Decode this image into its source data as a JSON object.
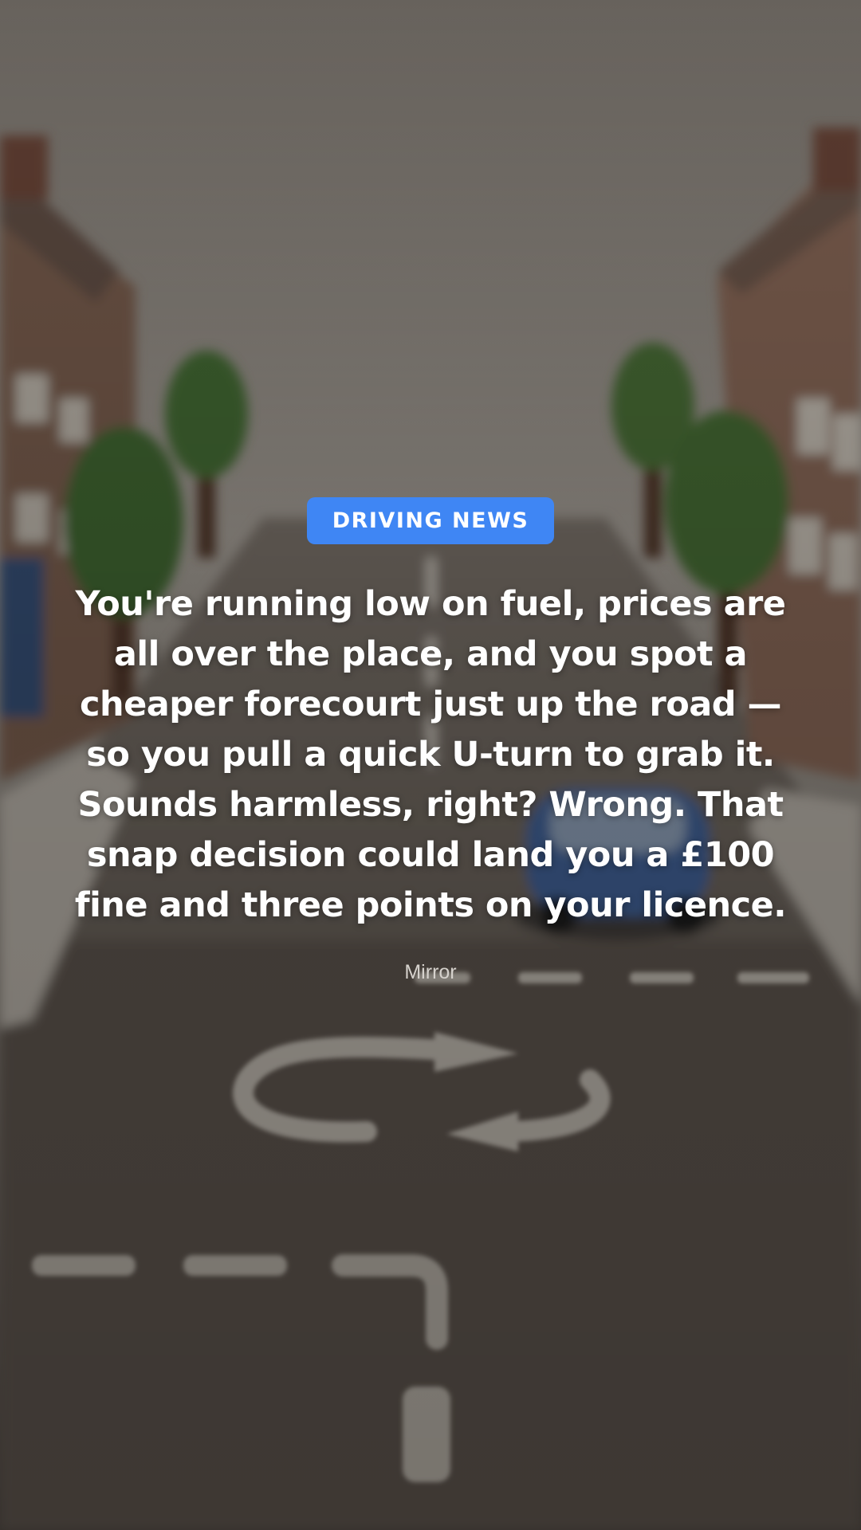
{
  "story": {
    "category": "DRIVING NEWS",
    "headline": "You're running low on fuel, prices are all over the place, and you spot a cheaper forecourt just up the road — so you pull a quick U-turn to grab it. Sounds harmless, right? Wrong. That snap decision could land you a £100 fine and three points on your licence.",
    "source": "Mirror"
  },
  "colors": {
    "badge": "#3f86f4",
    "headline_text": "#ffffff",
    "source_text": "#d6d2cd"
  }
}
